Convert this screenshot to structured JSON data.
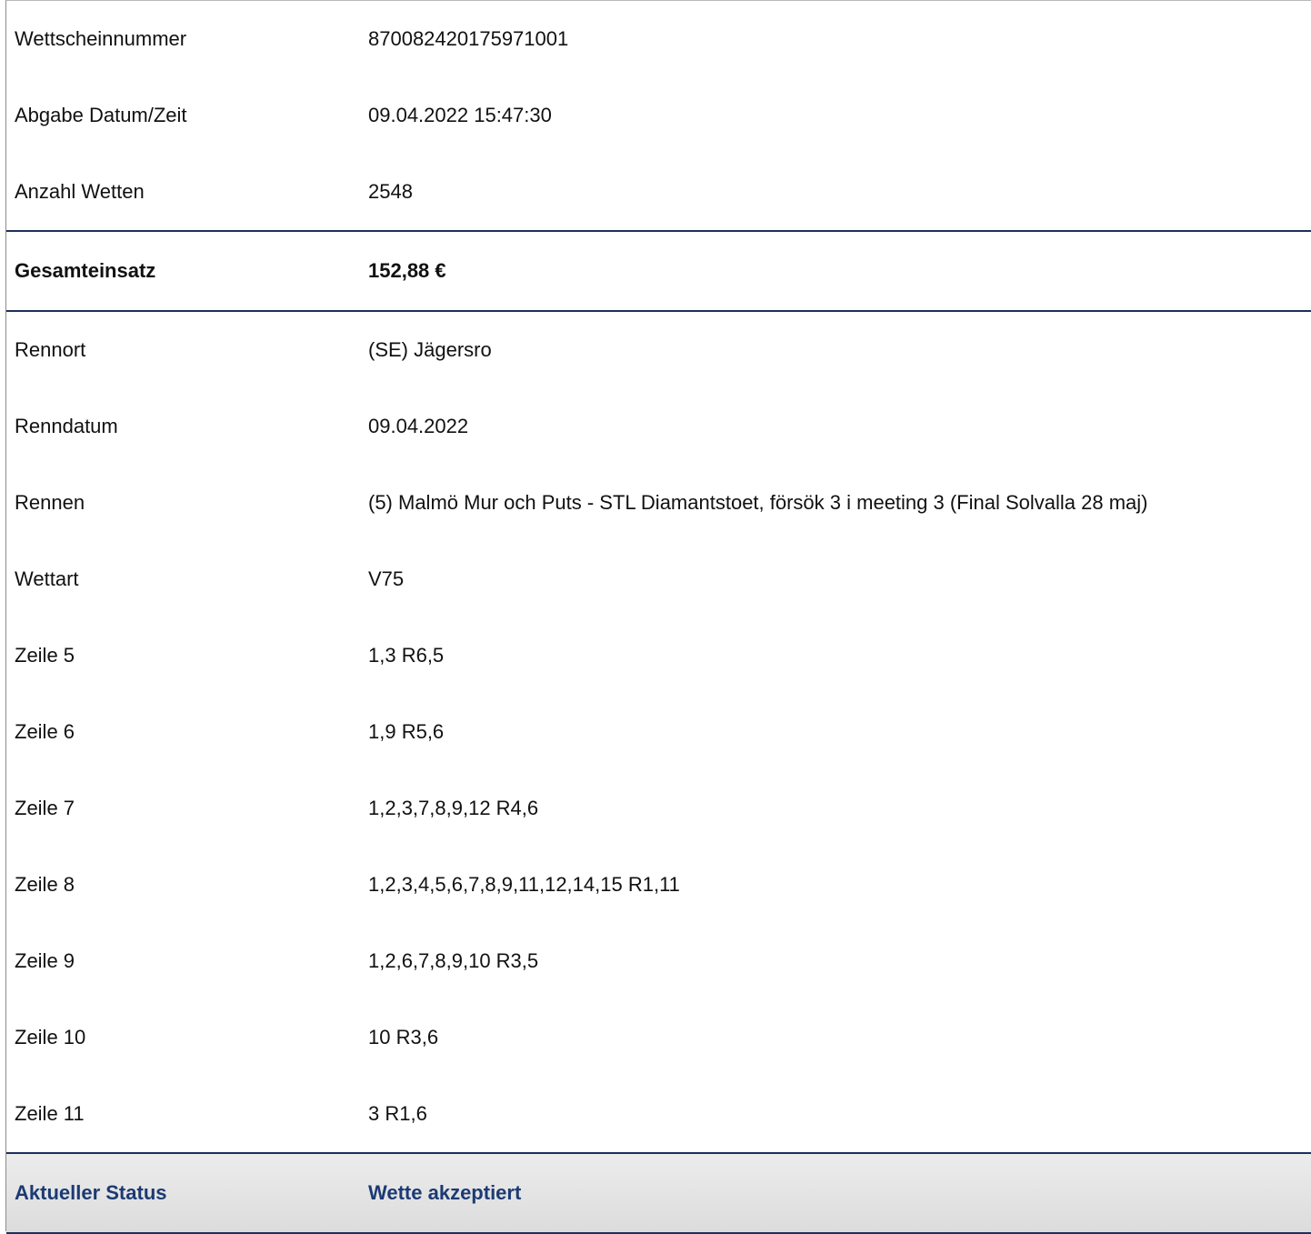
{
  "ticket_info": [
    {
      "label": "Wettscheinnummer",
      "value": "870082420175971001"
    },
    {
      "label": "Abgabe Datum/Zeit",
      "value": "09.04.2022 15:47:30"
    },
    {
      "label": "Anzahl Wetten",
      "value": "2548"
    }
  ],
  "total": {
    "label": "Gesamteinsatz",
    "value": "152,88 €"
  },
  "race_details": [
    {
      "label": "Rennort",
      "value": "(SE) Jägersro"
    },
    {
      "label": "Renndatum",
      "value": "09.04.2022"
    },
    {
      "label": "Rennen",
      "value": "(5) Malmö Mur och Puts - STL Diamantstoet, försök 3 i meeting 3 (Final Solvalla 28 maj)"
    },
    {
      "label": "Wettart",
      "value": "V75"
    },
    {
      "label": "Zeile 5",
      "value": "1,3 R6,5"
    },
    {
      "label": "Zeile 6",
      "value": "1,9 R5,6"
    },
    {
      "label": "Zeile 7",
      "value": "1,2,3,7,8,9,12 R4,6"
    },
    {
      "label": "Zeile 8",
      "value": "1,2,3,4,5,6,7,8,9,11,12,14,15 R1,11"
    },
    {
      "label": "Zeile 9",
      "value": "1,2,6,7,8,9,10 R3,5"
    },
    {
      "label": "Zeile 10",
      "value": "10 R3,6"
    },
    {
      "label": "Zeile 11",
      "value": "3 R1,6"
    }
  ],
  "status": {
    "label": "Aktueller Status",
    "value": "Wette akzeptiert"
  },
  "colors": {
    "divider": "#1f2f5c",
    "status_text": "#1c3a73",
    "status_background": "#e4e4e4"
  }
}
